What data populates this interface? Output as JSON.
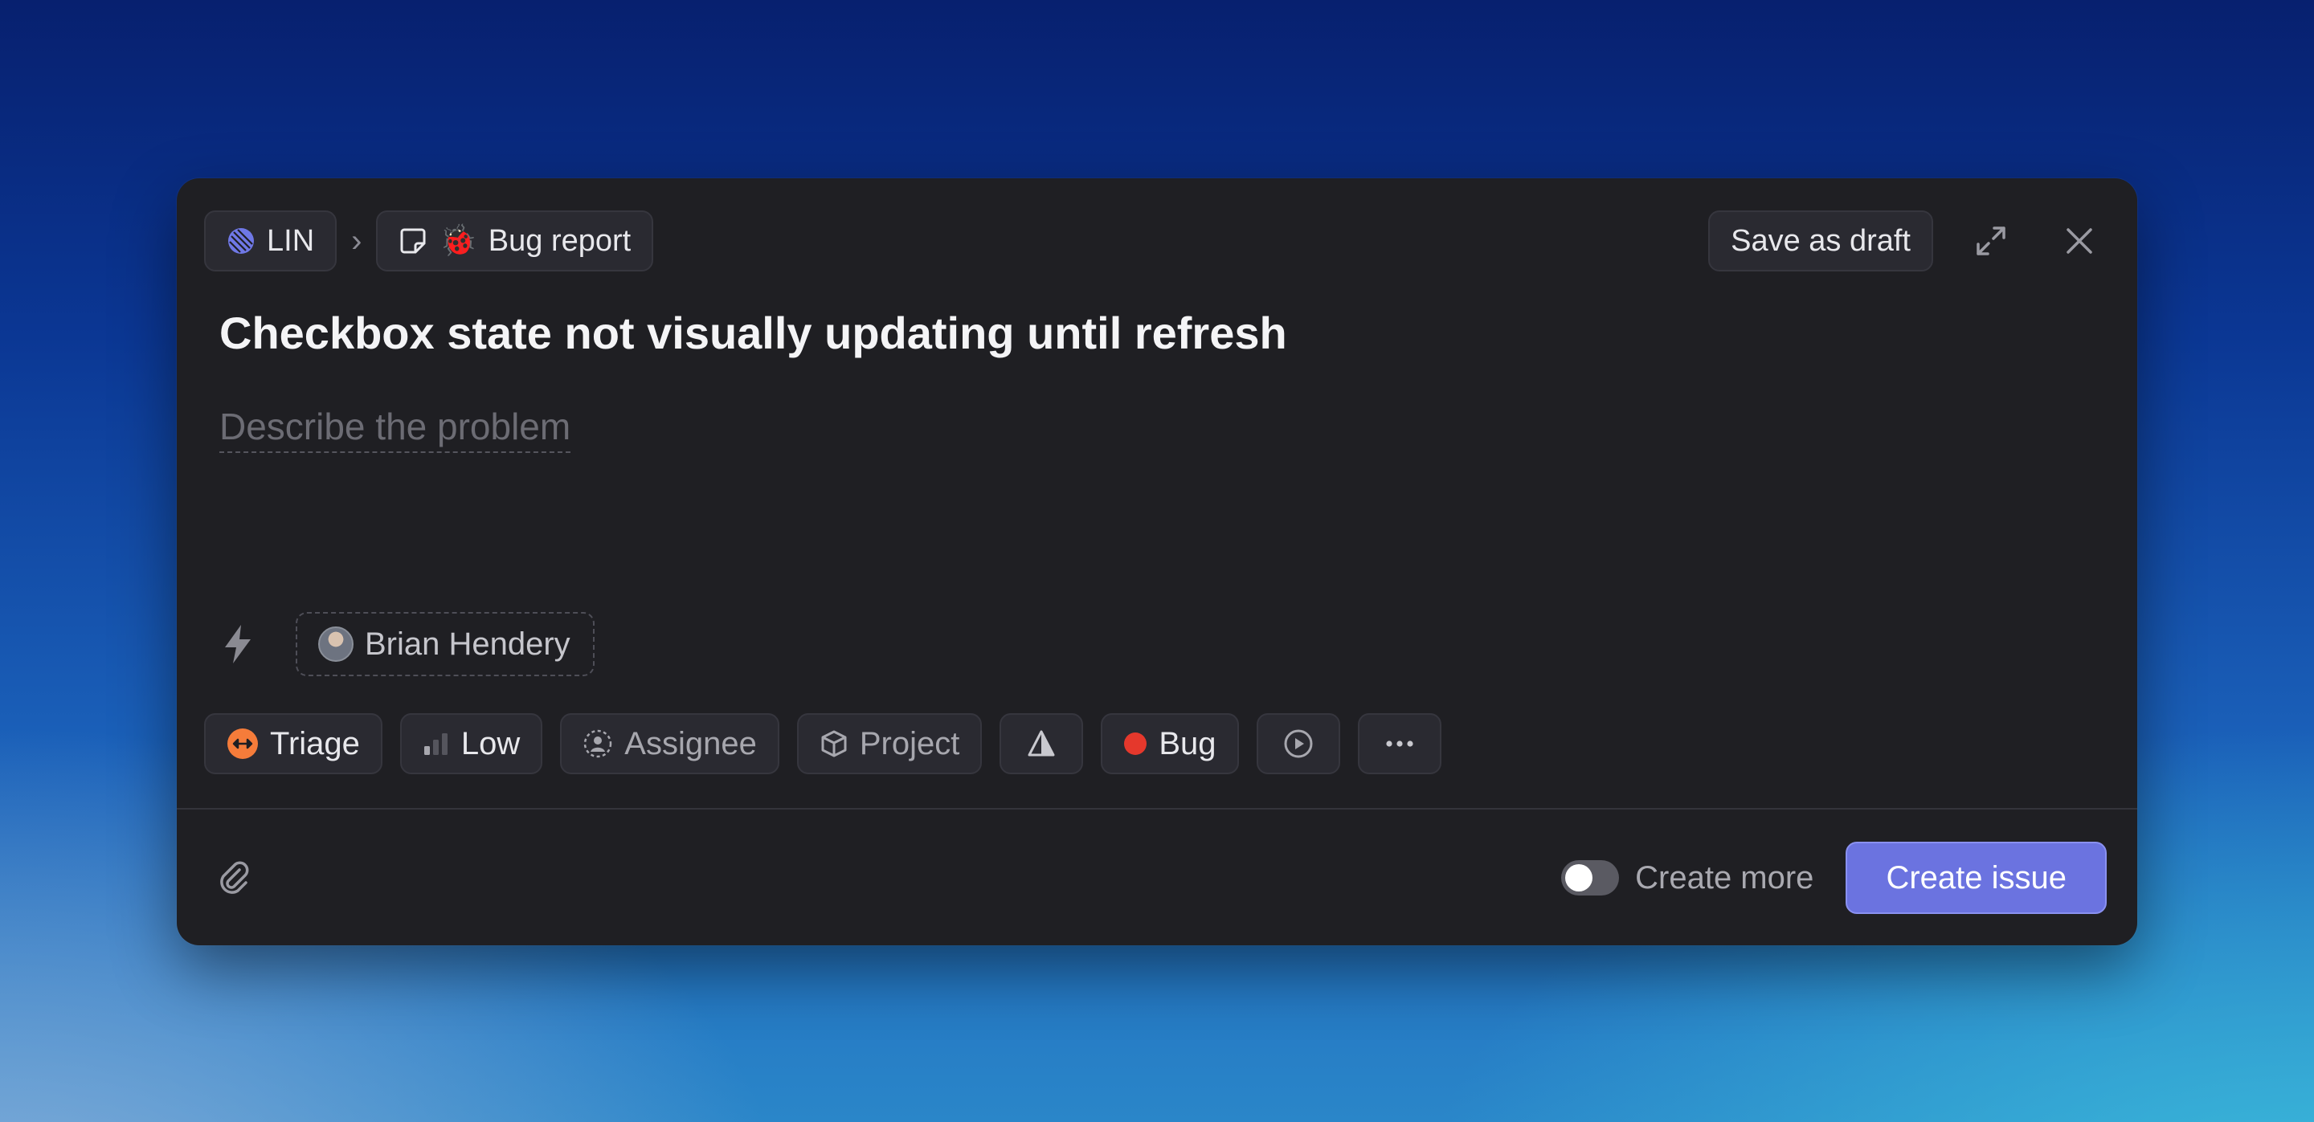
{
  "breadcrumb": {
    "team_label": "LIN",
    "team_icon": "linear-logo-icon",
    "separator": "›",
    "template_label": "Bug report",
    "template_emoji": "🐞"
  },
  "toolbar": {
    "save_draft_label": "Save as draft",
    "expand_icon": "expand-icon",
    "close_icon": "close-icon"
  },
  "issue": {
    "title": "Checkbox state not visually updating until refresh",
    "description_placeholder": "Describe the problem"
  },
  "template_row": {
    "icon": "lightning-icon",
    "user_name": "Brian Hendery"
  },
  "properties": [
    {
      "label": "Triage",
      "icon": "triage-icon"
    },
    {
      "label": "Low",
      "icon": "priority-low-icon"
    },
    {
      "label": "Assignee",
      "icon": "assignee-icon"
    },
    {
      "label": "Project",
      "icon": "project-cube-icon"
    },
    {
      "label": "",
      "icon": "estimate-icon"
    },
    {
      "label": "Bug",
      "icon": "label-dot-icon",
      "color": "#e5382c"
    },
    {
      "label": "",
      "icon": "cycle-play-icon"
    },
    {
      "label": "",
      "icon": "more-icon"
    }
  ],
  "footer": {
    "attach_icon": "paperclip-icon",
    "create_more_label": "Create more",
    "create_more_on": false,
    "create_issue_label": "Create issue"
  },
  "colors": {
    "accent": "#6b73e0",
    "triage": "#f57c3a",
    "bug": "#e5382c",
    "modal_bg": "#1f1f23"
  }
}
